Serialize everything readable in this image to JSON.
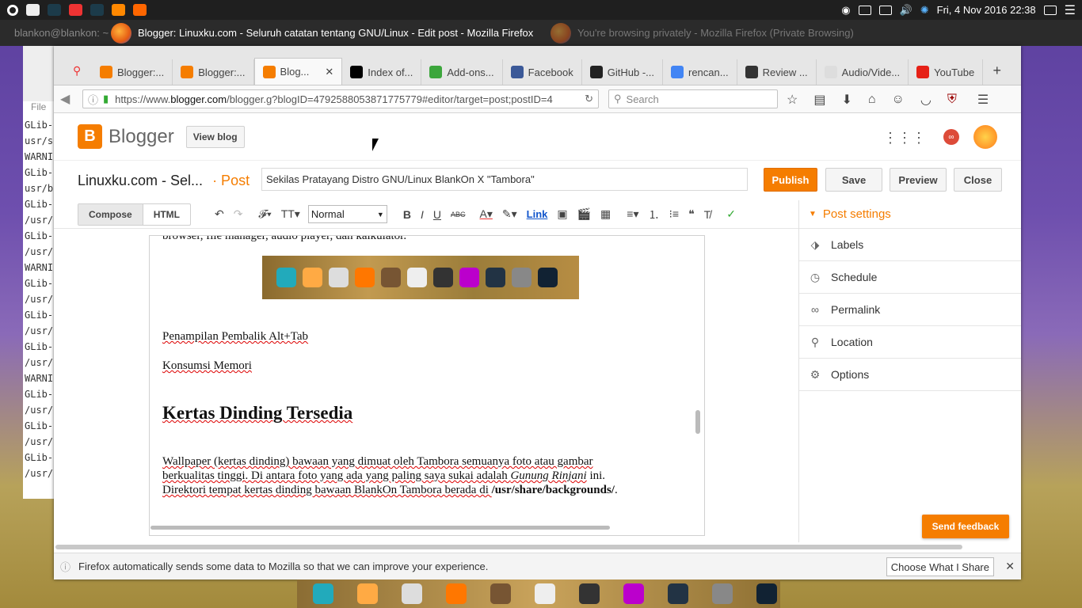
{
  "panel": {
    "datetime": "Fri, 4 Nov 2016 22:38"
  },
  "window_titles": {
    "terminal": "blankon@blankon: ~",
    "firefox": "Blogger: Linuxku.com - Seluruh catatan tentang GNU/Linux - Edit post - Mozilla Firefox",
    "private": "You're browsing privately - Mozilla Firefox (Private Browsing)"
  },
  "terminal": {
    "menu": "File",
    "lines": [
      "GLib-",
      "usr/s",
      "WARNI",
      "GLib-",
      "usr/b",
      "GLib-",
      "/usr/",
      "GLib-",
      "/usr/",
      "WARNI",
      "GLib-",
      "/usr/",
      "GLib-",
      "/usr/",
      "GLib-",
      "/usr/",
      "WARNI",
      "GLib-",
      "/usr/",
      "GLib-",
      "/usr/",
      "GLib-",
      "/usr/"
    ]
  },
  "tabs": [
    {
      "label": "Blogger:...",
      "color": "#f57d00"
    },
    {
      "label": "Blogger:...",
      "color": "#f57d00"
    },
    {
      "label": "Blog...",
      "color": "#f57d00",
      "active": true
    },
    {
      "label": "Index of...",
      "color": "#000000"
    },
    {
      "label": "Add-ons...",
      "color": "#3ca63c"
    },
    {
      "label": "Facebook",
      "color": "#3b5998"
    },
    {
      "label": "GitHub -...",
      "color": "#222222"
    },
    {
      "label": "rencan...",
      "color": "#4285f4"
    },
    {
      "label": "Review ...",
      "color": "#333333"
    },
    {
      "label": "Audio/Vide...",
      "color": "#dddddd"
    },
    {
      "label": "YouTube",
      "color": "#e62117"
    }
  ],
  "nav": {
    "url_prefix": "https://www.",
    "url_domain": "blogger.com",
    "url_rest": "/blogger.g?blogID=4792588053871775779#editor/target=post;postID=4",
    "search_placeholder": "Search"
  },
  "blogger": {
    "brand": "Blogger",
    "view_blog": "View blog",
    "gplus": "∞"
  },
  "post": {
    "blog_title": "Linuxku.com - Sel...",
    "post_label": "· Post",
    "title_value": "Sekilas Pratayang Distro GNU/Linux BlankOn X \"Tambora\"",
    "publish": "Publish",
    "save": "Save",
    "preview": "Preview",
    "close": "Close"
  },
  "toolbar": {
    "compose": "Compose",
    "html": "HTML",
    "format": "Normal",
    "link": "Link"
  },
  "editor": {
    "top_cut": "browser, file manager, audio player, dan kalkulator.",
    "alt_tab": "Penampilan Pembalik Alt+Tab",
    "memori": "Konsumsi Memori",
    "heading": "Kertas Dinding Tersedia",
    "p1": "Wallpaper (kertas dinding) bawaan yang dimuat oleh Tambora semuanya foto atau gambar",
    "p2a": "berkualitas tinggi. Di antara foto yang ada yang paling saya sukai adalah ",
    "p2em": "Gunung Rinjani",
    "p2b": " ini.",
    "p3a": "Direktori tempat kertas dinding bawaan BlankOn Tambora berada di ",
    "p3b": "/usr/share/backgrounds/",
    "p3c": "."
  },
  "sidebar": {
    "header": "Post settings",
    "items": [
      {
        "label": "Labels",
        "icon": "tag-icon"
      },
      {
        "label": "Schedule",
        "icon": "clock-icon"
      },
      {
        "label": "Permalink",
        "icon": "link-icon"
      },
      {
        "label": "Location",
        "icon": "pin-icon"
      },
      {
        "label": "Options",
        "icon": "gear-icon"
      }
    ]
  },
  "feedback": "Send feedback",
  "notice": {
    "text": "Firefox automatically sends some data to Mozilla so that we can improve your experience.",
    "button": "Choose What I Share"
  }
}
